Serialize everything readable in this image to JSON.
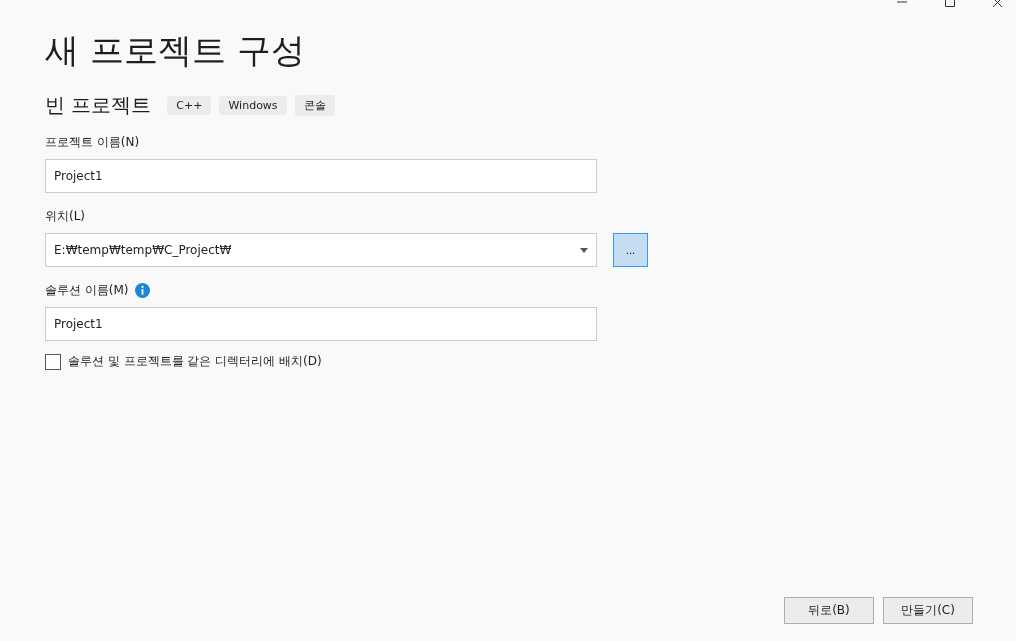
{
  "title": "새 프로젝트 구성",
  "template": {
    "name": "빈 프로젝트",
    "tags": [
      "C++",
      "Windows",
      "콘솔"
    ]
  },
  "fields": [
    {
      "kind": "text",
      "label": "프로젝트 이름(N)",
      "value": "Project1"
    },
    {
      "kind": "dropdown",
      "label": "위치(L)",
      "value": "E:₩temp₩temp₩C_Project₩",
      "browse": "..."
    },
    {
      "kind": "text",
      "label": "솔루션 이름(M)",
      "value": "Project1",
      "info": true
    }
  ],
  "checkbox": {
    "label": "솔루션 및 프로젝트를 같은 디렉터리에 배치(D)",
    "checked": false
  },
  "buttons": [
    "뒤로(B)",
    "만들기(C)"
  ]
}
